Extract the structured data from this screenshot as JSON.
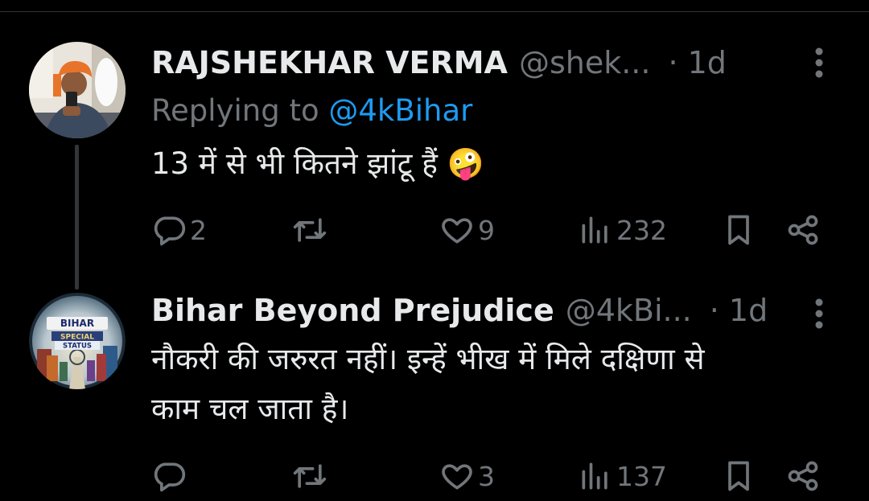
{
  "tweets": [
    {
      "display_name": "RAJSHEKHAR VERMA",
      "handle": "@shek...",
      "time": "· 1d",
      "reply_prefix": "Replying to",
      "reply_to": "@4kBihar",
      "text": "13 में से भी कितने झांटू हैं 🤪",
      "replies": "2",
      "retweets": "",
      "likes": "9",
      "views": "232"
    },
    {
      "display_name": "Bihar Beyond Prejudice",
      "handle": "@4kBi...",
      "time": "· 1d",
      "text_line1": "नौकरी की जरुरत नहीं। इन्हें भीख में मिले दक्षिणा से",
      "text_line2": "काम चल जाता है।",
      "replies": "",
      "retweets": "",
      "likes": "3",
      "views": "137",
      "avatar_label": {
        "top": "BIHAR",
        "middle": "SPECIAL",
        "bottom": "STATUS"
      }
    }
  ],
  "icons": {
    "reply": "reply-icon",
    "retweet": "retweet-icon",
    "like": "heart-icon",
    "views": "views-icon",
    "bookmark": "bookmark-icon",
    "share": "share-icon",
    "more": "more-icon"
  },
  "colors": {
    "background": "#000000",
    "text": "#e7e9ea",
    "muted": "#71767b",
    "link": "#1d9bf0"
  }
}
